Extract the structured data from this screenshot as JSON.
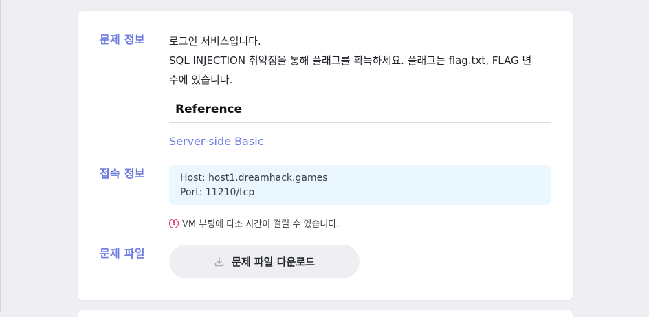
{
  "sections": {
    "info_label": "문제 정보",
    "connection_label": "접속 정보",
    "file_label": "문제 파일"
  },
  "description": {
    "line1": "로그인 서비스입니다.",
    "line2": "SQL INJECTION 취약점을 통해 플래그를 획득하세요. 플래그는 flag.txt, FLAG 변",
    "line3": "수에 있습니다."
  },
  "reference": {
    "title": "Reference",
    "link_text": "Server-side Basic"
  },
  "connection": {
    "host": "Host: host1.dreamhack.games",
    "port": "Port: 11210/tcp"
  },
  "notice": {
    "icon": "exclamation-circle-icon",
    "text": "VM 부팅에 다소 시간이 걸릴 수 있습니다."
  },
  "download": {
    "icon": "download-icon",
    "label": "문제 파일 다운로드"
  },
  "colors": {
    "accent": "#6b7be0",
    "conn_box_bg": "#ebf7fe",
    "notice_icon": "#e0245e",
    "button_bg": "#efeff3"
  }
}
